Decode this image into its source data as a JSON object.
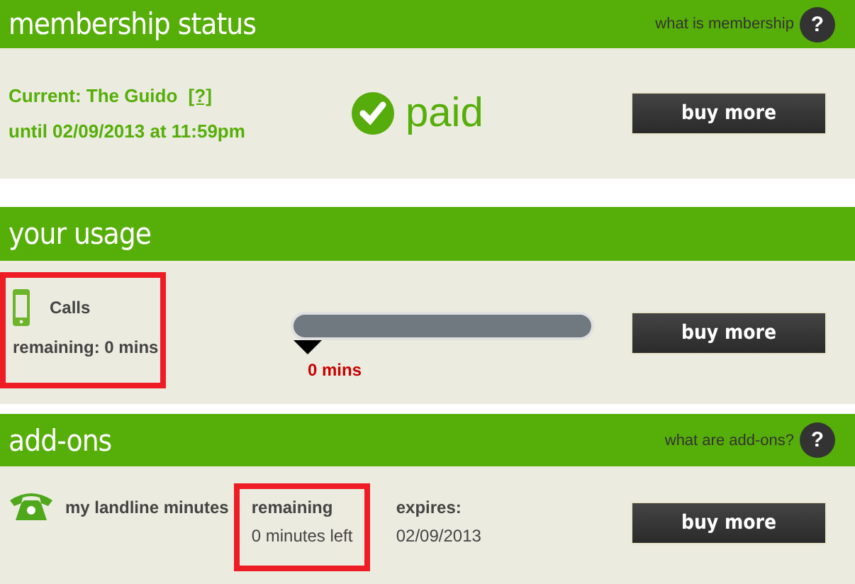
{
  "membership": {
    "title": "membership status",
    "help_link": "what is membership",
    "help_icon": "?",
    "current": "Current: The Guido",
    "current_help": "[?]",
    "until": "until 02/09/2013 at 11:59pm",
    "status": "paid",
    "button": "buy more"
  },
  "usage": {
    "title": "your usage",
    "label": "Calls",
    "remaining": "remaining: 0 mins",
    "highlighted": true,
    "reading": "0 mins",
    "button": "buy more"
  },
  "addons": {
    "title": "add-ons",
    "help_link": "what are add-ons?",
    "help_icon": "?",
    "name": "my landline minutes",
    "remaining_label": "remaining",
    "remaining_value": "0 minutes left",
    "highlighted": true,
    "expires_label": "expires:",
    "expires_value": "02/09/2013",
    "button": "buy more"
  }
}
